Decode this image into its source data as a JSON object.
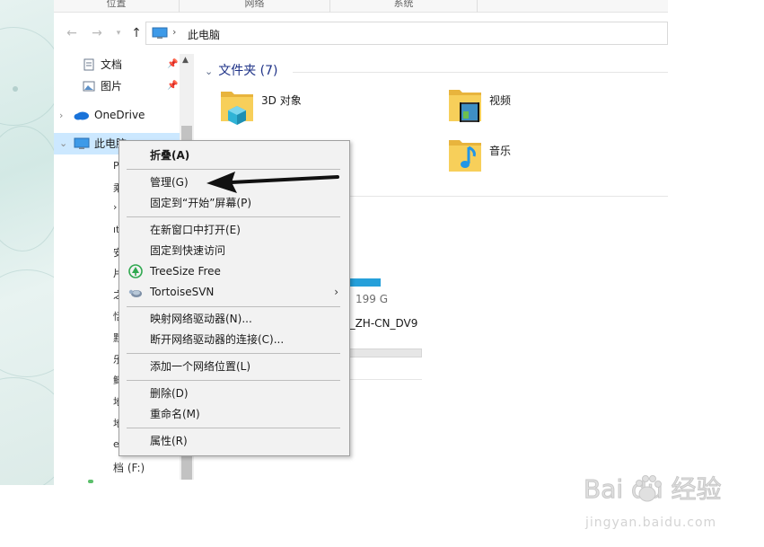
{
  "ribbon": {
    "groups": [
      "位置",
      "网络",
      "系统"
    ]
  },
  "address": {
    "crumb": "此电脑",
    "separator": "›"
  },
  "nav_pane": {
    "quick_items": [
      {
        "label": "文档",
        "icon": "document-icon"
      },
      {
        "label": "图片",
        "icon": "pictures-icon"
      }
    ],
    "onedrive": "OneDrive",
    "this_pc": "此电脑",
    "drive_stubs": [
      "P",
      "乘",
      "›",
      "ıt",
      "安",
      "片",
      "之",
      "恬",
      "默",
      "乐",
      "鲥",
      "地",
      "地",
      "e"
    ],
    "last_drive": "档 (F:)"
  },
  "content": {
    "folders_header": "文件夹 (7)",
    "folders": [
      {
        "label": "3D 对象",
        "icon": "3d-objects-folder-icon"
      },
      {
        "label": "视频",
        "icon": "videos-folder-icon"
      },
      {
        "label": "音乐",
        "icon": "music-folder-icon"
      }
    ],
    "drive_size": "199 G",
    "drive_name": "E_ZH-CN_DV9",
    "drive_usage_fraction": 0.53
  },
  "context_menu": {
    "items": [
      {
        "label": "折叠(A)",
        "bold": true
      },
      {
        "label": "管理(G)"
      },
      {
        "label": "固定到“开始”屏幕(P)"
      },
      {
        "label": "在新窗口中打开(E)"
      },
      {
        "label": "固定到快速访问"
      },
      {
        "label": "TreeSize Free",
        "icon": "treesize-icon"
      },
      {
        "label": "TortoiseSVN",
        "icon": "tortoisesvn-icon",
        "submenu": true
      },
      {
        "label": "映射网络驱动器(N)..."
      },
      {
        "label": "断开网络驱动器的连接(C)..."
      },
      {
        "label": "添加一个网络位置(L)"
      },
      {
        "label": "删除(D)"
      },
      {
        "label": "重命名(M)"
      },
      {
        "label": "属性(R)"
      }
    ]
  },
  "watermark": {
    "brand": "Bai du 经验",
    "url": "jingyan.baidu.com"
  },
  "colors": {
    "selection": "#cce8ff",
    "accent_blue": "#1e3287",
    "drive_bar": "#26a0da",
    "menu_bg": "#f2f2f2"
  }
}
